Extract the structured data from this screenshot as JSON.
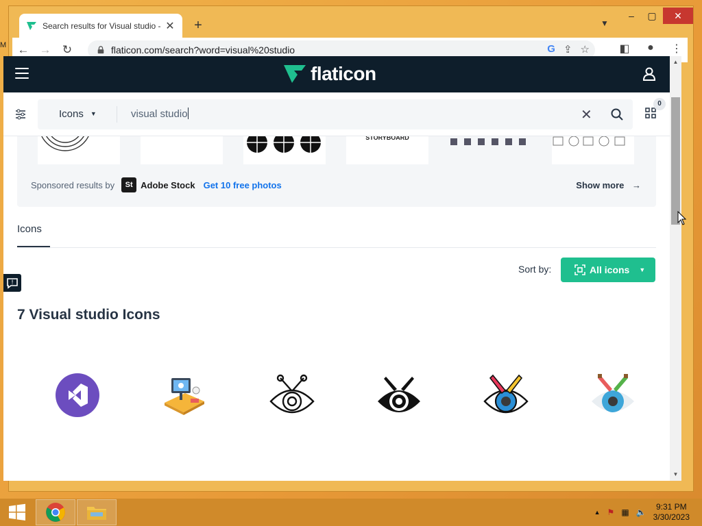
{
  "desktop": {
    "label": "M"
  },
  "browser": {
    "tab_title": "Search results for Visual studio -",
    "url": "flaticon.com/search?word=visual%20studio"
  },
  "site": {
    "logo_text": "flaticon",
    "search": {
      "type_label": "Icons",
      "query": "visual studio"
    },
    "collection_count": "0"
  },
  "sponsored": {
    "label": "Sponsored results by",
    "logo_text": "St",
    "brand": "Adobe Stock",
    "offer": "Get 10 free photos",
    "show_more": "Show more",
    "storyboard_text": "STORYBOARD"
  },
  "tabs": {
    "icons_label": "Icons"
  },
  "sort": {
    "label": "Sort by:",
    "value": "All icons"
  },
  "results": {
    "title": "7 Visual studio Icons",
    "icons": [
      "visual-studio-logo-icon",
      "designer-desk-icon",
      "eye-brush-outline-icon",
      "eye-brush-glyph-icon",
      "eye-brush-lineal-color-icon",
      "eye-brush-flat-icon"
    ]
  },
  "taskbar": {
    "time": "9:31 PM",
    "date": "3/30/2023"
  },
  "colors": {
    "header_bg": "#0e1e2b",
    "accent_green": "#1fbf8f",
    "link_blue": "#1273eb",
    "vs_purple": "#6c4dbf"
  }
}
